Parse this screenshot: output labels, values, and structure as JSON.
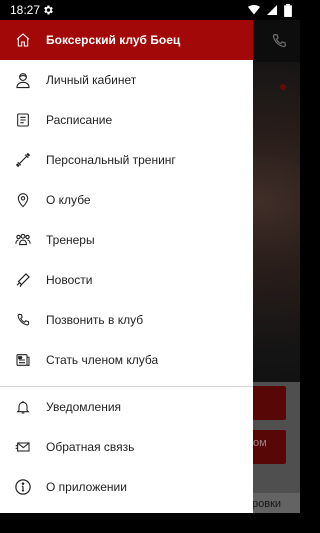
{
  "status_bar": {
    "time": "18:27"
  },
  "background": {
    "button2_text": "ом",
    "bottom_text": "ровки"
  },
  "drawer": {
    "header": {
      "title": "Боксерский клуб Боец",
      "icon": "home-icon"
    },
    "items": [
      {
        "label": "Личный кабинет",
        "icon": "user-icon"
      },
      {
        "label": "Расписание",
        "icon": "schedule-icon"
      },
      {
        "label": "Персональный тренинг",
        "icon": "dumbbell-icon"
      },
      {
        "label": "О клубе",
        "icon": "location-icon"
      },
      {
        "label": "Тренеры",
        "icon": "trainers-icon"
      },
      {
        "label": "Новости",
        "icon": "megaphone-icon"
      },
      {
        "label": "Позвонить в клуб",
        "icon": "phone-icon"
      },
      {
        "label": "Стать членом клуба",
        "icon": "membership-icon"
      }
    ],
    "items_secondary": [
      {
        "label": "Уведомления",
        "icon": "bell-icon"
      },
      {
        "label": "Обратная связь",
        "icon": "feedback-icon"
      },
      {
        "label": "О приложении",
        "icon": "info-icon"
      }
    ]
  },
  "colors": {
    "accent": "#a20808",
    "drawer_bg": "#ffffff",
    "text": "#1f1f1f"
  }
}
